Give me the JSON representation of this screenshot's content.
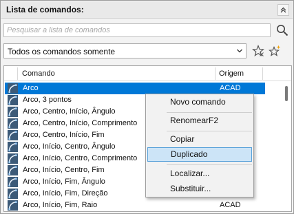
{
  "panel": {
    "title": "Lista de comandos:",
    "collapse_icon": "double-chevron-up-icon"
  },
  "search": {
    "placeholder": "Pesquisar a lista de comandos",
    "value": "",
    "icon": "search-icon"
  },
  "filter": {
    "selected": "Todos os comandos somente",
    "arrow_icon": "chevron-down-icon",
    "star_icon": "star-filter-icon",
    "new_star_icon": "new-star-filter-icon"
  },
  "list": {
    "columns": {
      "command": "Comando",
      "origin": "Origem"
    },
    "rows": [
      {
        "name": "Arco",
        "origin": "ACAD",
        "selected": true
      },
      {
        "name": "Arco, 3 pontos",
        "origin": ""
      },
      {
        "name": "Arco, Centro, Início, Ângulo",
        "origin": ""
      },
      {
        "name": "Arco, Centro, Início, Comprimento",
        "origin": ""
      },
      {
        "name": "Arco, Centro, Início, Fim",
        "origin": ""
      },
      {
        "name": "Arco, Início, Centro, Ângulo",
        "origin": ""
      },
      {
        "name": "Arco, Início, Centro, Comprimento",
        "origin": ""
      },
      {
        "name": "Arco, Início, Centro, Fim",
        "origin": ""
      },
      {
        "name": "Arco, Início, Fim, Ângulo",
        "origin": ""
      },
      {
        "name": "Arco, Início, Fim, Direção",
        "origin": ""
      },
      {
        "name": "Arco, Início, Fim, Raio",
        "origin": "ACAD"
      }
    ],
    "row_icon": "arc-icon"
  },
  "context_menu": {
    "items": [
      {
        "label": "Novo comando"
      },
      {
        "label": "RenomearF2"
      },
      {
        "label": "Copiar"
      },
      {
        "label": "Duplicado",
        "highlighted": true
      },
      {
        "label": "Localizar..."
      },
      {
        "label": "Substituir..."
      }
    ]
  },
  "colors": {
    "selection": "#0078d7",
    "menu_highlight": "#cce4f7",
    "menu_highlight_border": "#56a0d9"
  }
}
